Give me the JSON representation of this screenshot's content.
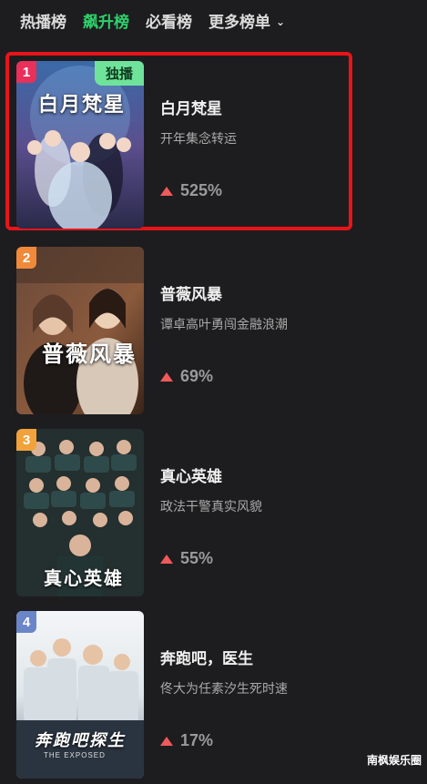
{
  "tabs": {
    "hot": "热播榜",
    "rising": "飙升榜",
    "must_watch": "必看榜",
    "more": "更多榜单"
  },
  "items": [
    {
      "rank": "1",
      "rank_color": "#e8305a",
      "badge": "独播",
      "poster_text": "白月梵星",
      "title": "白月梵星",
      "subtitle": "开年集念转运",
      "change": "525%"
    },
    {
      "rank": "2",
      "rank_color": "#f08a3a",
      "poster_text": "普薇风暴",
      "title": "普薇风暴",
      "subtitle": "谭卓高叶勇闯金融浪潮",
      "change": "69%"
    },
    {
      "rank": "3",
      "rank_color": "#f2a23a",
      "poster_text": "真心英雄",
      "title": "真心英雄",
      "subtitle": "政法干警真实风貌",
      "change": "55%"
    },
    {
      "rank": "4",
      "rank_color": "#6a86c8",
      "poster_text": "奔跑吧探生",
      "poster_subtext": "THE EXPOSED",
      "title": "奔跑吧，医生",
      "subtitle": "佟大为任素汐生死时速",
      "change": "17%"
    }
  ],
  "watermark": "南枫娱乐圈",
  "colors": {
    "accent": "#2fd16c",
    "highlight_border": "#e8141a",
    "up_arrow": "#f05a5a"
  }
}
